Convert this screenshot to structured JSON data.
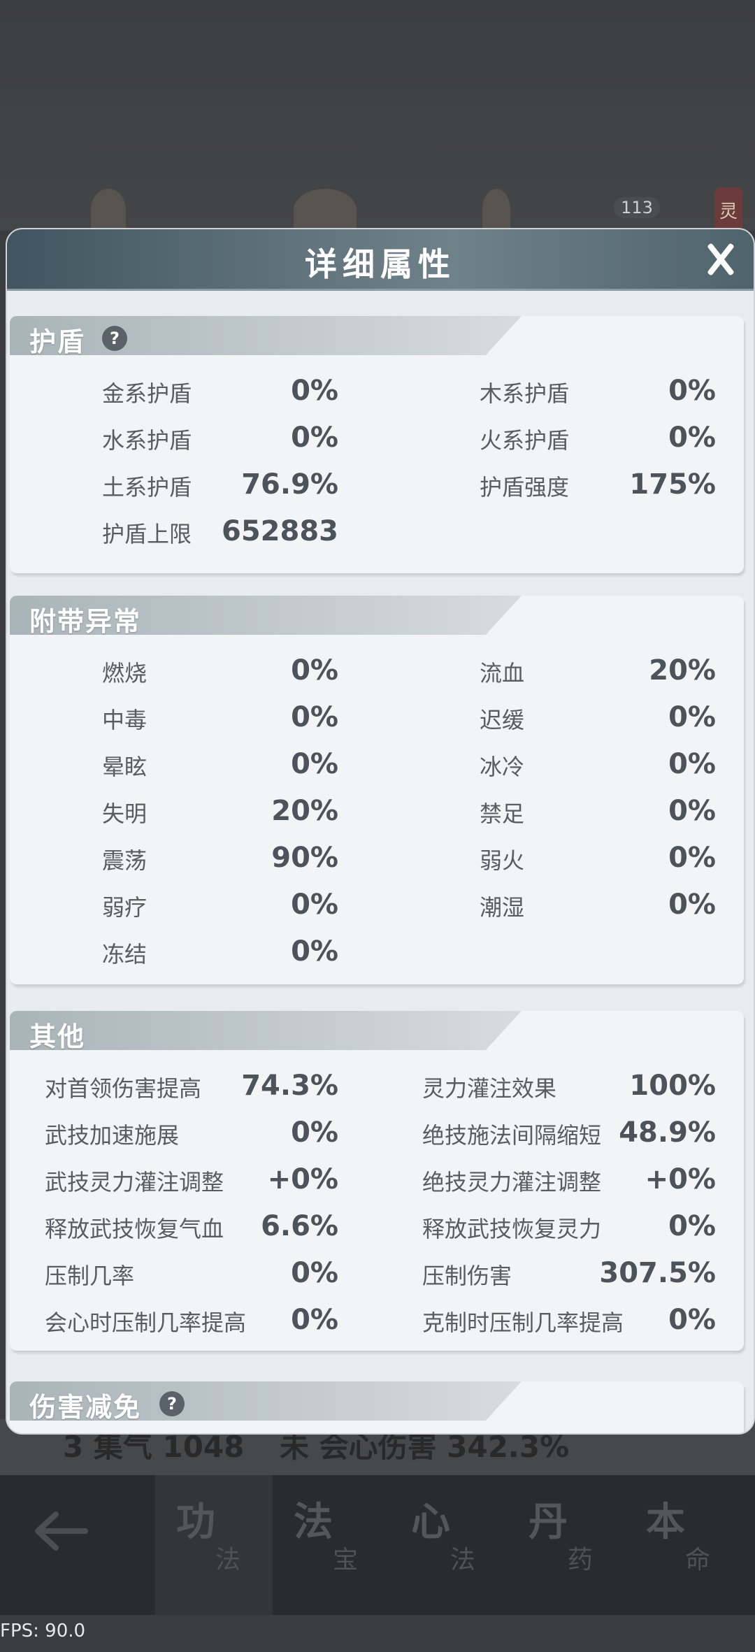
{
  "background": {
    "counter": "113",
    "side_tag": "灵",
    "stats_left": "3 集气 1048",
    "stats_right": "未 会心伤害 342.3%"
  },
  "modal": {
    "title": "详细属性",
    "close_icon": "close-icon"
  },
  "sections": {
    "shield": {
      "title": "护盾",
      "help": "?",
      "rows": [
        {
          "label": "金系护盾",
          "value": "0%"
        },
        {
          "label": "木系护盾",
          "value": "0%"
        },
        {
          "label": "水系护盾",
          "value": "0%"
        },
        {
          "label": "火系护盾",
          "value": "0%"
        },
        {
          "label": "土系护盾",
          "value": "76.9%"
        },
        {
          "label": "护盾强度",
          "value": "175%"
        },
        {
          "label": "护盾上限",
          "value": "652883"
        }
      ]
    },
    "abnormal": {
      "title": "附带异常",
      "rows": [
        {
          "label": "燃烧",
          "value": "0%"
        },
        {
          "label": "流血",
          "value": "20%"
        },
        {
          "label": "中毒",
          "value": "0%"
        },
        {
          "label": "迟缓",
          "value": "0%"
        },
        {
          "label": "晕眩",
          "value": "0%"
        },
        {
          "label": "冰冷",
          "value": "0%"
        },
        {
          "label": "失明",
          "value": "20%"
        },
        {
          "label": "禁足",
          "value": "0%"
        },
        {
          "label": "震荡",
          "value": "90%"
        },
        {
          "label": "弱火",
          "value": "0%"
        },
        {
          "label": "弱疗",
          "value": "0%"
        },
        {
          "label": "潮湿",
          "value": "0%"
        },
        {
          "label": "冻结",
          "value": "0%"
        }
      ]
    },
    "other": {
      "title": "其他",
      "rows": [
        {
          "label": "对首领伤害提高",
          "value": "74.3%"
        },
        {
          "label": "灵力灌注效果",
          "value": "100%"
        },
        {
          "label": "武技加速施展",
          "value": "0%"
        },
        {
          "label": "绝技施法间隔缩短",
          "value": "48.9%"
        },
        {
          "label": "武技灵力灌注调整",
          "value": "+0%"
        },
        {
          "label": "绝技灵力灌注调整",
          "value": "+0%"
        },
        {
          "label": "释放武技恢复气血",
          "value": "6.6%"
        },
        {
          "label": "释放武技恢复灵力",
          "value": "0%"
        },
        {
          "label": "压制几率",
          "value": "0%"
        },
        {
          "label": "压制伤害",
          "value": "307.5%"
        },
        {
          "label": "会心时压制几率提高",
          "value": "0%"
        },
        {
          "label": "克制时压制几率提高",
          "value": "0%"
        }
      ]
    },
    "damage_reduction": {
      "title": "伤害减免",
      "help": "?"
    }
  },
  "bottom_nav": {
    "back_icon": "back-arrow-icon",
    "tabs": [
      {
        "big": "功",
        "small": "法"
      },
      {
        "big": "法",
        "small": "宝"
      },
      {
        "big": "心",
        "small": "法"
      },
      {
        "big": "丹",
        "small": "药"
      },
      {
        "big": "本",
        "small": "命"
      }
    ]
  },
  "fps": "FPS: 90.0"
}
